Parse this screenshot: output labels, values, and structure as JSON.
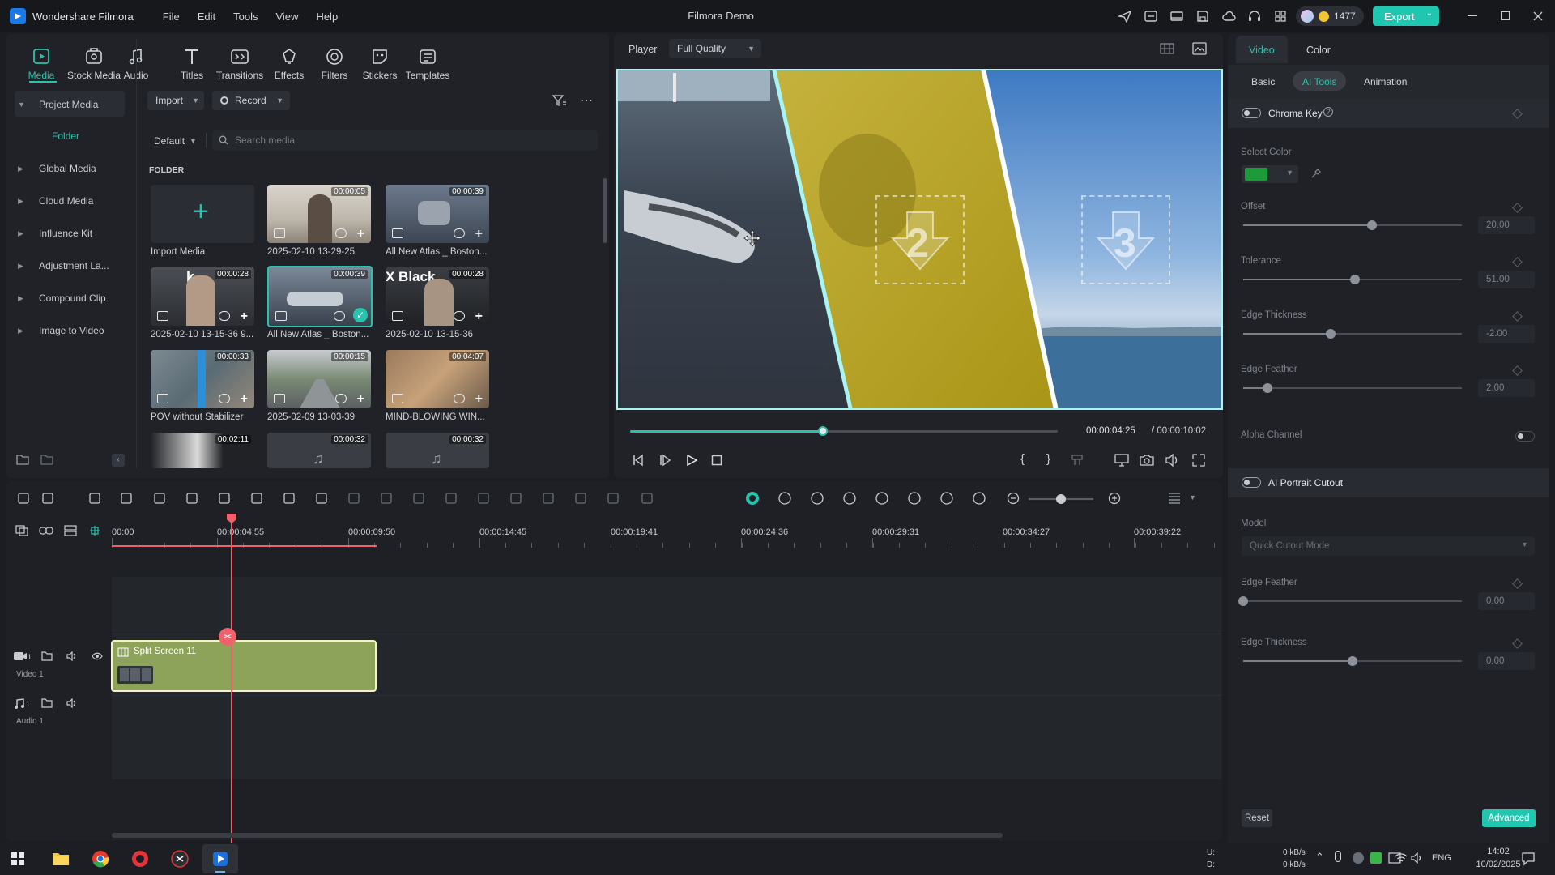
{
  "app": {
    "name": "Wondershare Filmora",
    "window_title": "Filmora Demo",
    "menu": [
      "File",
      "Edit",
      "Tools",
      "View",
      "Help"
    ],
    "coins": "1477",
    "export_label": "Export"
  },
  "toolbar": [
    "Media",
    "Stock Media",
    "Audio",
    "Titles",
    "Transitions",
    "Effects",
    "Filters",
    "Stickers",
    "Templates"
  ],
  "sidebar": {
    "items": [
      "Project Media",
      "Folder",
      "Global Media",
      "Cloud Media",
      "Influence Kit",
      "Adjustment La...",
      "Compound Clip",
      "Image to Video"
    ]
  },
  "media": {
    "import_label": "Import",
    "record_label": "Record",
    "sort_label": "Default",
    "search_placeholder": "Search media",
    "folder_header": "FOLDER",
    "import_media_label": "Import Media",
    "items": [
      {
        "name": "2025-02-10 13-29-25",
        "duration": "00:00:05"
      },
      {
        "name": "All New Atlas _ Boston...",
        "duration": "00:00:39"
      },
      {
        "name": "2025-02-10 13-15-36 9...",
        "duration": "00:00:28"
      },
      {
        "name": "All New Atlas _ Boston...",
        "duration": "00:00:39"
      },
      {
        "name": "2025-02-10 13-15-36",
        "duration": "00:00:28"
      },
      {
        "name": "POV without Stabilizer",
        "duration": "00:00:33"
      },
      {
        "name": "2025-02-09 13-03-39",
        "duration": "00:00:15"
      },
      {
        "name": "MIND-BLOWING WIN...",
        "duration": "00:04:07"
      },
      {
        "name": "",
        "duration": "00:02:11"
      },
      {
        "name": "",
        "duration": "00:00:32"
      },
      {
        "name": "",
        "duration": "00:00:32"
      }
    ],
    "thumb_texts": {
      "k": "k",
      "xblack": "X Black"
    }
  },
  "player": {
    "label": "Player",
    "quality": "Full Quality",
    "current_time": "00:00:04:25",
    "total_time": "/ 00:00:10:02",
    "progress": 0.45,
    "numbers": [
      "2",
      "3"
    ]
  },
  "right_panel": {
    "tabs": [
      "Video",
      "Color"
    ],
    "subtabs": [
      "Basic",
      "AI Tools",
      "Animation"
    ],
    "chroma_key": {
      "label": "Chroma Key",
      "select_color_label": "Select Color",
      "color": "#1e9a3a",
      "params": [
        {
          "label": "Offset",
          "value": "20.00",
          "level": 0.59
        },
        {
          "label": "Tolerance",
          "value": "51.00",
          "level": 0.51
        },
        {
          "label": "Edge Thickness",
          "value": "-2.00",
          "level": 0.4
        },
        {
          "label": "Edge Feather",
          "value": "2.00",
          "level": 0.11
        }
      ],
      "alpha_channel_label": "Alpha Channel"
    },
    "portrait": {
      "label": "AI Portrait Cutout",
      "model_label": "Model",
      "model_value": "Quick Cutout Mode",
      "params": [
        {
          "label": "Edge Feather",
          "value": "0.00",
          "level": 0.0
        },
        {
          "label": "Edge Thickness",
          "value": "0.00",
          "level": 0.5
        }
      ]
    },
    "reset_label": "Reset",
    "advanced_label": "Advanced"
  },
  "timeline": {
    "ruler": [
      "00:00",
      "00:00:04:55",
      "00:00:09:50",
      "00:00:14:45",
      "00:00:19:41",
      "00:00:24:36",
      "00:00:29:31",
      "00:00:34:27",
      "00:00:39:22"
    ],
    "tracks": [
      {
        "name": "Video 1",
        "index": "1"
      },
      {
        "name": "Audio 1",
        "index": "1"
      }
    ],
    "clip_label": "Split Screen 11",
    "zoom_level": 0.5
  },
  "taskbar": {
    "net_up": "0 kB/s",
    "net_down": "0 kB/s",
    "net_u": "U:",
    "net_d": "D:",
    "lang": "ENG",
    "time": "14:02",
    "date": "10/02/2025"
  },
  "colors": {
    "accent": "#1fc7b1",
    "playhead": "#f2616b",
    "clip": "#8ea35a",
    "bg": "#1b1d22",
    "panel": "#202227"
  }
}
